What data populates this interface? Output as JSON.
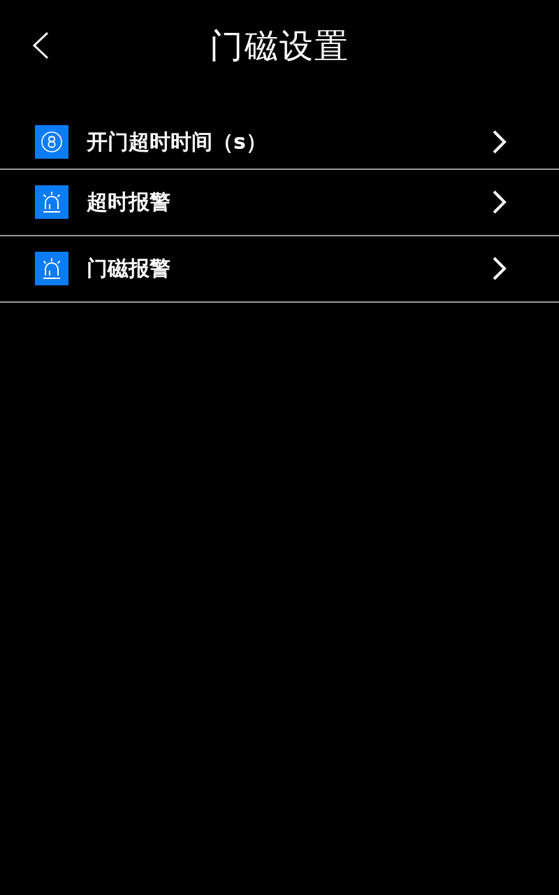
{
  "header": {
    "title": "门磁设置"
  },
  "items": [
    {
      "kind": "timer",
      "label": "开门超时时间（s）"
    },
    {
      "kind": "alarm",
      "label": "超时报警"
    },
    {
      "kind": "alarm",
      "label": "门磁报警"
    }
  ]
}
